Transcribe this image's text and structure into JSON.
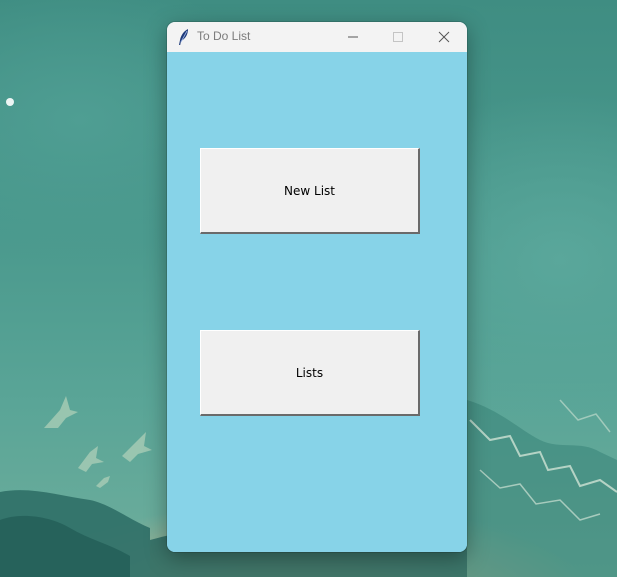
{
  "window": {
    "title": "To Do List",
    "icon": "feather-icon",
    "controls": {
      "minimize": "minimize-icon",
      "maximize": "maximize-icon",
      "close": "close-icon"
    }
  },
  "main": {
    "new_list_label": "New List",
    "lists_label": "Lists"
  },
  "colors": {
    "client_background": "#87d3e8",
    "button_face": "#f0f0f0",
    "titlebar": "#f3f3f3",
    "title_text": "#7c7c7c"
  }
}
